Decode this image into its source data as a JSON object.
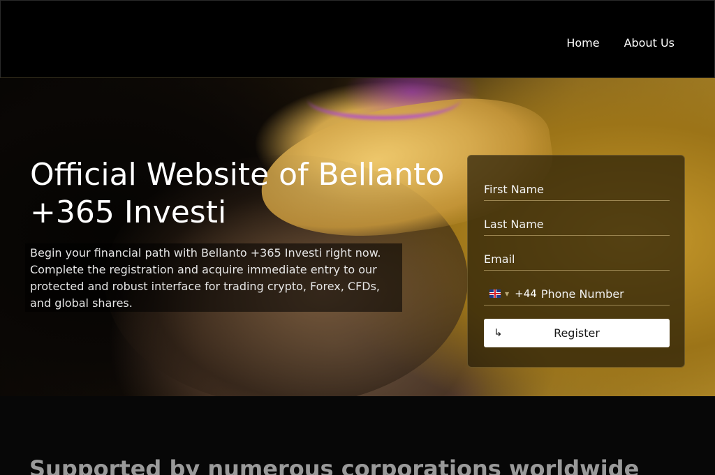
{
  "nav": {
    "links": [
      {
        "label": "Home"
      },
      {
        "label": "About Us"
      }
    ]
  },
  "hero": {
    "title": "Official Website of Bellanto +365 Investi",
    "description": "Begin your financial path with Bellanto +365 Investi right now. Complete the registration and acquire immediate entry to our protected and robust interface for trading crypto, Forex, CFDs, and global shares."
  },
  "form": {
    "first_name_placeholder": "First Name",
    "last_name_placeholder": "Last Name",
    "email_placeholder": "Email",
    "phone": {
      "country_icon": "uk-flag-icon",
      "dial_code": "+44",
      "placeholder": "Phone Number"
    },
    "register_icon": "arrow-return-icon",
    "register_label": "Register"
  },
  "support": {
    "heading": "Supported by numerous corporations worldwide"
  },
  "colors": {
    "nav_background": "#000000",
    "card_border": "#967d46",
    "button_background": "#ffffff",
    "heading_gray": "#9a9a9a"
  }
}
